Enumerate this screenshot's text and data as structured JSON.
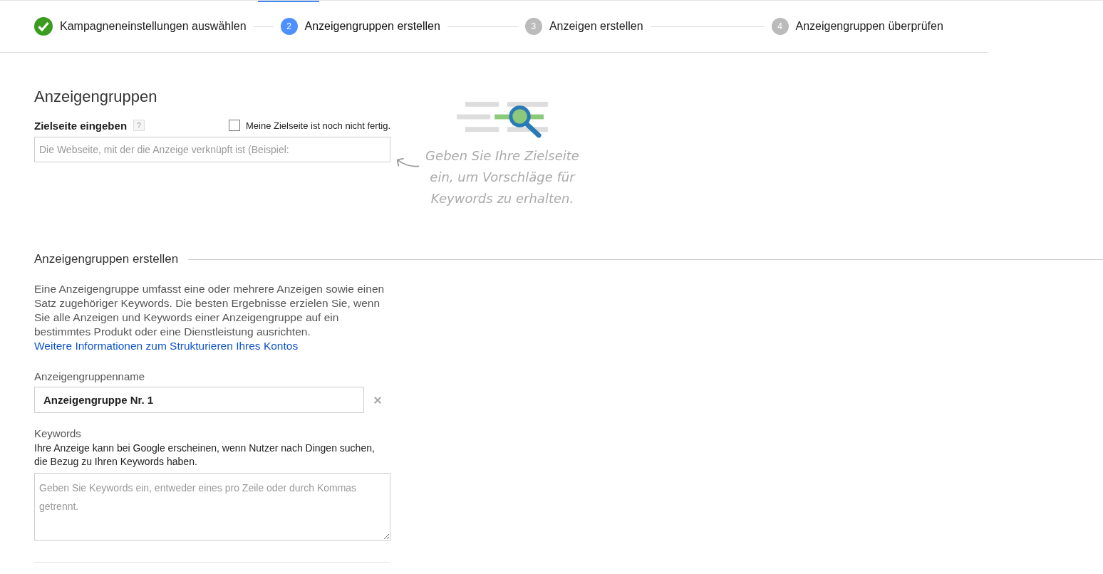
{
  "steps": [
    {
      "kind": "done",
      "label": "Kampagneneinstellungen auswählen",
      "selected": false
    },
    {
      "kind": "current",
      "number": "2",
      "label": "Anzeigengruppen erstellen",
      "selected": true
    },
    {
      "kind": "upcoming",
      "number": "3",
      "label": "Anzeigen erstellen",
      "selected": false
    },
    {
      "kind": "upcoming",
      "number": "4",
      "label": "Anzeigengruppen überprüfen",
      "selected": false
    }
  ],
  "page_title": "Anzeigengruppen",
  "landing_page": {
    "label": "Zielseite eingeben",
    "help": "?",
    "not_ready": {
      "label": "Meine Zielseite ist noch nicht fertig.",
      "checked": false
    },
    "placeholder": "Die Webseite, mit der die Anzeige verknüpft ist (Beispiel:",
    "hint": "Geben Sie Ihre Zielseite ein, um Vorschläge für Keywords zu erhalten."
  },
  "create_section": {
    "title": "Anzeigengruppen erstellen",
    "description": "Eine Anzeigengruppe umfasst eine oder mehrere Anzeigen sowie einen Satz zugehöriger Keywords. Die besten Ergebnisse erzielen Sie, wenn Sie alle Anzeigen und Keywords einer Anzeigengruppe auf ein bestimmtes Produkt oder eine Dienstleistung ausrichten.",
    "link": "Weitere Informationen zum Strukturieren Ihres Kontos"
  },
  "ad_group_name": {
    "label": "Anzeigengruppenname",
    "value": "Anzeigengruppe Nr. 1"
  },
  "keywords": {
    "label": "Keywords",
    "description": "Ihre Anzeige kann bei Google erscheinen, wenn Nutzer nach Dingen suchen, die Bezug zu Ihren Keywords haben.",
    "placeholder": "Geben Sie Keywords ein, entweder eines pro Zeile oder durch Kommas getrennt."
  }
}
